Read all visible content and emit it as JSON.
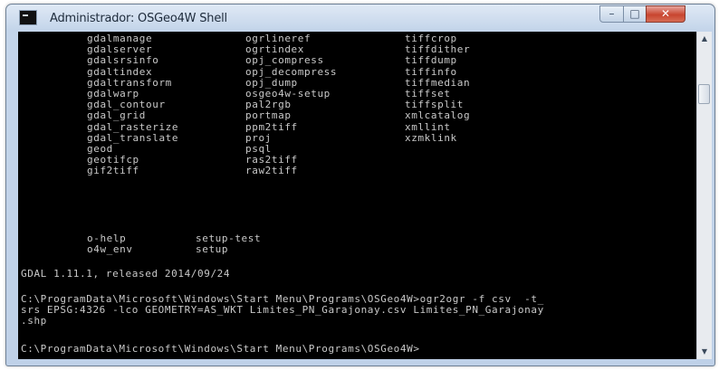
{
  "window": {
    "title": "Administrador: OSGeo4W Shell",
    "controls": {
      "minimize": "–",
      "maximize": "□",
      "close": "✕"
    }
  },
  "console": {
    "commands": [
      [
        "gdalmanage",
        "ogrlineref",
        "tiffcrop"
      ],
      [
        "gdalserver",
        "ogrtindex",
        "tiffdither"
      ],
      [
        "gdalsrsinfo",
        "opj_compress",
        "tiffdump"
      ],
      [
        "gdaltindex",
        "opj_decompress",
        "tiffinfo"
      ],
      [
        "gdaltransform",
        "opj_dump",
        "tiffmedian"
      ],
      [
        "gdalwarp",
        "osgeo4w-setup",
        "tiffset"
      ],
      [
        "gdal_contour",
        "pal2rgb",
        "tiffsplit"
      ],
      [
        "gdal_grid",
        "portmap",
        "xmlcatalog"
      ],
      [
        "gdal_rasterize",
        "ppm2tiff",
        "xmllint"
      ],
      [
        "gdal_translate",
        "proj",
        "xzmklink"
      ],
      [
        "geod",
        "psql",
        ""
      ],
      [
        "geotifcp",
        "ras2tiff",
        ""
      ],
      [
        "gif2tiff",
        "raw2tiff",
        ""
      ]
    ],
    "extras": [
      [
        "o-help",
        "setup-test"
      ],
      [
        "o4w_env",
        "setup"
      ]
    ],
    "version": "GDAL 1.11.1, released 2014/09/24",
    "prompt_lines": [
      "C:\\ProgramData\\Microsoft\\Windows\\Start Menu\\Programs\\OSGeo4W>ogr2ogr -f csv  -t_",
      "srs EPSG:4326 -lco GEOMETRY=AS_WKT Limites_PN_Garajonay.csv Limites_PN_Garajonay",
      ".shp"
    ],
    "current_prompt": "C:\\ProgramData\\Microsoft\\Windows\\Start Menu\\Programs\\OSGeo4W>"
  },
  "scrollbar": {
    "up": "▲",
    "down": "▼"
  }
}
